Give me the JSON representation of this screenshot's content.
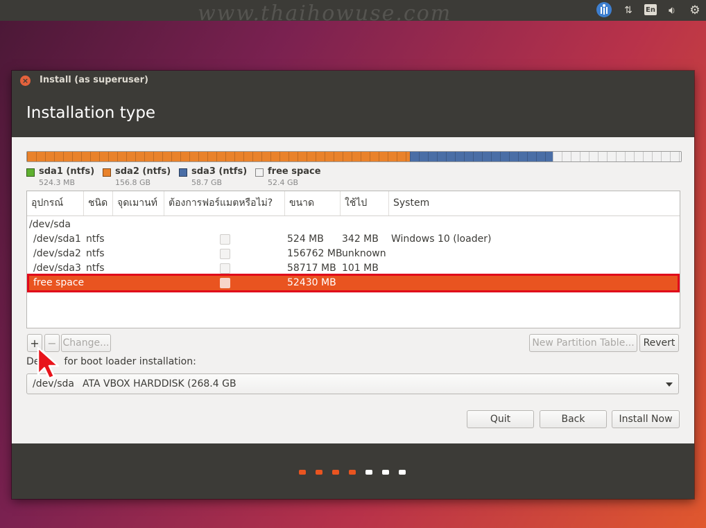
{
  "watermark": "www.thaihowuse.com",
  "topbar": {
    "icons": [
      "accessibility-icon",
      "network-icon",
      "keyboard-layout-icon",
      "volume-icon",
      "power-icon"
    ],
    "keyboard_layout": "En"
  },
  "window": {
    "title": "Install (as superuser)",
    "heading": "Installation type"
  },
  "partition_bar": [
    {
      "name": "sda1 (ntfs)",
      "size": "524.3 MB",
      "color": "#5fb030"
    },
    {
      "name": "sda2 (ntfs)",
      "size": "156.8 GB",
      "color": "#e9822b"
    },
    {
      "name": "sda3 (ntfs)",
      "size": "58.7 GB",
      "color": "#4a6ea6"
    },
    {
      "name": "free space",
      "size": "52.4 GB",
      "color": "#f2f2f2"
    }
  ],
  "table": {
    "columns": [
      "อุปกรณ์",
      "ชนิด",
      "จุดเมานท์",
      "ต้องการฟอร์แมตหรือไม่?",
      "ขนาด",
      "ใช้ไป",
      "System"
    ],
    "disk": "/dev/sda",
    "rows": [
      {
        "device": "/dev/sda1",
        "type": "ntfs",
        "mount": "",
        "size": "524 MB",
        "used": "342 MB",
        "system": "Windows 10 (loader)"
      },
      {
        "device": "/dev/sda2",
        "type": "ntfs",
        "mount": "",
        "size": "156762 MB",
        "used": "unknown",
        "system": ""
      },
      {
        "device": "/dev/sda3",
        "type": "ntfs",
        "mount": "",
        "size": "58717 MB",
        "used": "101 MB",
        "system": ""
      },
      {
        "device": "free space",
        "type": "",
        "mount": "",
        "size": "52430 MB",
        "used": "",
        "system": "",
        "selected": true
      }
    ]
  },
  "toolbar": {
    "add_label": "+",
    "remove_label": "−",
    "change_label": "Change...",
    "new_table_label": "New Partition Table...",
    "revert_label": "Revert"
  },
  "bootloader": {
    "label_prefix": "De",
    "label_suffix": "for boot loader installation:",
    "device": "/dev/sda",
    "description": "ATA VBOX HARDDISK (268.4 GB"
  },
  "actions": {
    "quit_label": "Quit",
    "back_label": "Back",
    "install_label": "Install Now"
  },
  "progress": {
    "total_steps": 7,
    "completed_steps": 4,
    "done_color": "#e95420",
    "todo_color": "#ffffff"
  }
}
